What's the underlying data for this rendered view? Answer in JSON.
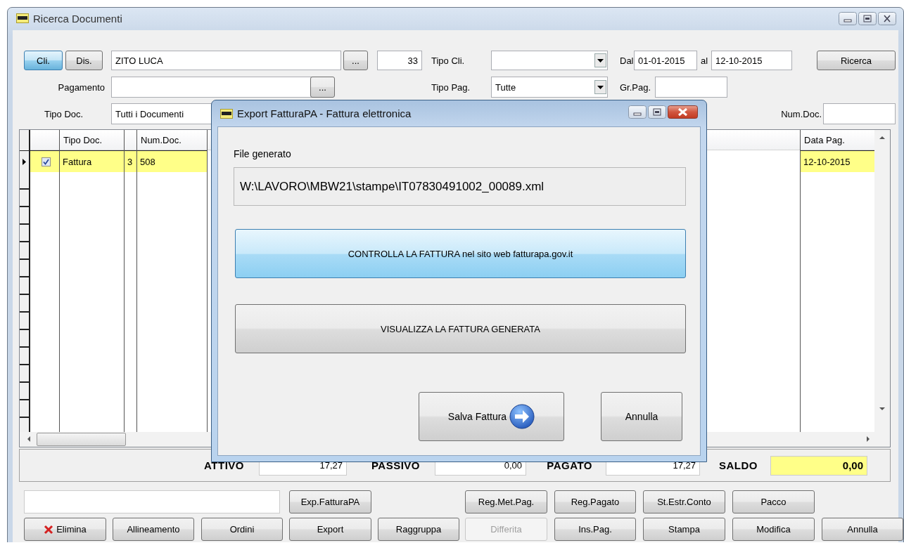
{
  "window": {
    "title": "Ricerca Documenti"
  },
  "filter": {
    "modes": [
      {
        "label": "Cli.",
        "selected": true
      },
      {
        "label": "Dis.",
        "selected": false
      }
    ],
    "client": "ZITO LUCA",
    "client_browse": "...",
    "client_code": "33",
    "tipo_cli_label": "Tipo Cli.",
    "dal_label": "Dal",
    "dal": "01-01-2015",
    "al_label": "al",
    "al": "12-10-2015",
    "search_button": {
      "label": "Ricerca"
    },
    "pagamento_label": "Pagamento",
    "pagamento_browse": "...",
    "tipo_pag_label": "Tipo Pag.",
    "tipo_pag": "Tutte",
    "gr_pag_label": "Gr.Pag.",
    "tipo_doc_label": "Tipo Doc.",
    "tipo_doc": "Tutti i Documenti",
    "num_doc_label": "Num.Doc."
  },
  "table": {
    "columns": [
      "Tipo Doc.",
      "",
      "Num.Doc.",
      "Data Pag."
    ],
    "rows": [
      {
        "selected": true,
        "checked": true,
        "cells": [
          "Fattura",
          "3",
          "508",
          "12-10-2015"
        ]
      }
    ]
  },
  "totals": [
    {
      "label": "ATTIVO",
      "value": "17,27",
      "highlight": false
    },
    {
      "label": "PASSIVO",
      "value": "0,00",
      "highlight": false
    },
    {
      "label": "PAGATO",
      "value": "17,27",
      "highlight": false
    },
    {
      "label": "SALDO",
      "value": "0,00",
      "highlight": true
    }
  ],
  "buttons_top": [
    {
      "label": "Exp.FatturaPA",
      "disabled": false
    },
    {
      "label": "Reg.Met.Pag.",
      "disabled": false
    },
    {
      "label": "Reg.Pagato",
      "disabled": false
    },
    {
      "label": "St.Estr.Conto",
      "disabled": false
    },
    {
      "label": "Pacco",
      "disabled": false
    }
  ],
  "buttons": [
    {
      "label": "Elimina",
      "kind": "delete",
      "disabled": false
    },
    {
      "label": "Allineamento",
      "kind": "plain",
      "disabled": false
    },
    {
      "label": "Ordini",
      "kind": "plain",
      "disabled": false
    },
    {
      "label": "Export",
      "kind": "plain",
      "disabled": false
    },
    {
      "label": "Raggruppa",
      "kind": "plain",
      "disabled": false
    },
    {
      "label": "Differita",
      "kind": "plain",
      "disabled": true
    },
    {
      "label": "Ins.Pag.",
      "kind": "plain",
      "disabled": false
    },
    {
      "label": "Stampa",
      "kind": "plain",
      "disabled": false
    },
    {
      "label": "Modifica",
      "kind": "plain",
      "disabled": false
    },
    {
      "label": "Annulla",
      "kind": "plain",
      "disabled": false
    }
  ],
  "dialog": {
    "title": "Export FatturaPA - Fattura elettronica",
    "file_label": "File generato",
    "file_path": "W:\\LAVORO\\MBW21\\stampe\\IT07830491002_00089.xml",
    "actions": [
      {
        "label": "CONTROLLA LA FATTURA nel sito web fatturapa.gov.it",
        "focused": true
      },
      {
        "label": "VISUALIZZA LA FATTURA GENERATA",
        "focused": false
      }
    ],
    "footer_buttons": [
      {
        "label": "Salva Fattura",
        "kind": "next"
      },
      {
        "label": "Annulla",
        "kind": "plain"
      }
    ]
  }
}
